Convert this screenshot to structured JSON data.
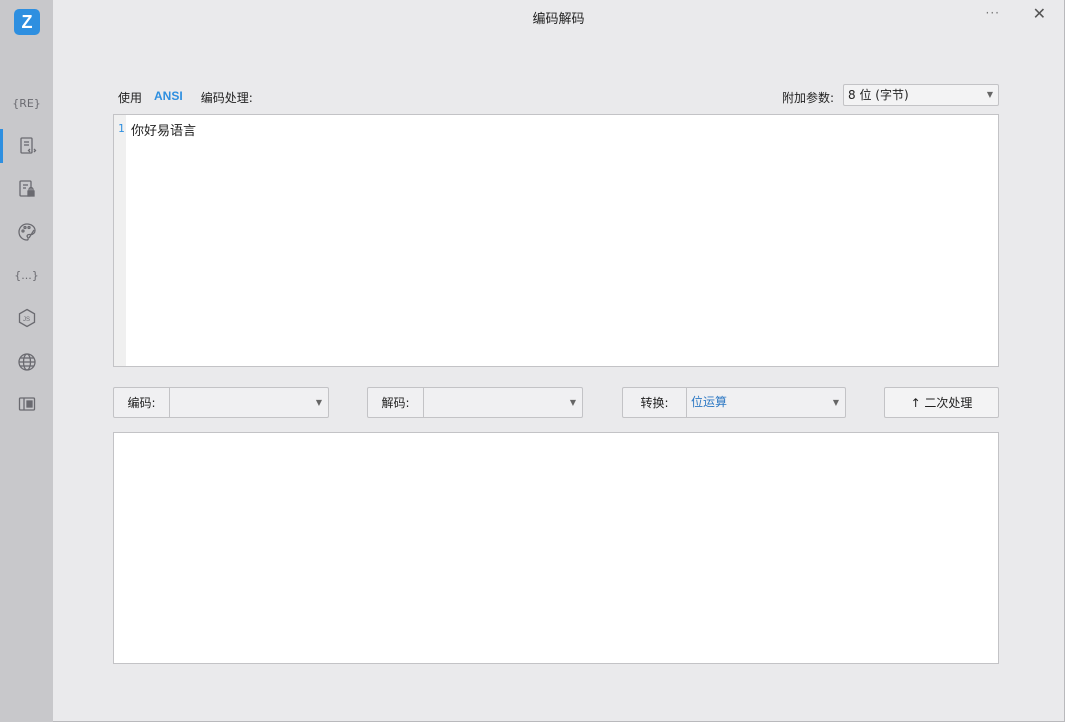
{
  "window": {
    "title": "编码解码",
    "more": "···",
    "close": "✕"
  },
  "sidebar": {
    "logo": "Z",
    "items": [
      {
        "name": "regex",
        "label": "{RE}"
      },
      {
        "name": "code-file",
        "label": ""
      },
      {
        "name": "file-lock",
        "label": ""
      },
      {
        "name": "palette",
        "label": ""
      },
      {
        "name": "json",
        "label": "{...}"
      },
      {
        "name": "nodejs",
        "label": ""
      },
      {
        "name": "globe",
        "label": ""
      },
      {
        "name": "book",
        "label": ""
      }
    ]
  },
  "toolbar": {
    "use_label": "使用",
    "encoding": "ANSI",
    "process_label": "编码处理:"
  },
  "param": {
    "label": "附加参数:",
    "value": "8 位 (字节)"
  },
  "editor": {
    "line_number": "1",
    "text": "你好易语言"
  },
  "controls": {
    "encode": {
      "label": "编码:",
      "value": ""
    },
    "decode": {
      "label": "解码:",
      "value": ""
    },
    "convert": {
      "label": "转换:",
      "value": "位运算"
    },
    "secondary_button": "↑ 二次处理"
  }
}
